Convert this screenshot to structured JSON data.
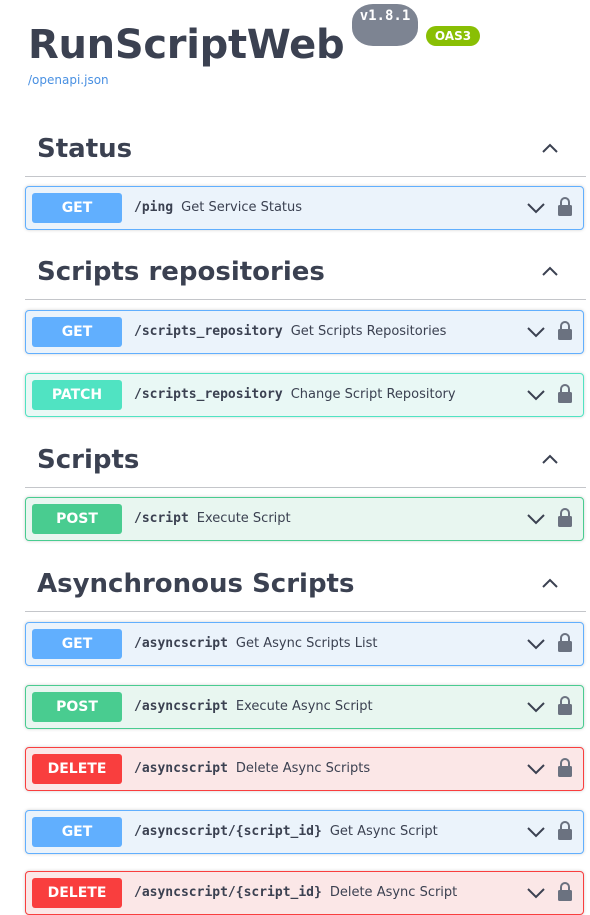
{
  "info": {
    "title": "RunScriptWeb",
    "version": "v1.8.1",
    "oas_badge": "OAS3",
    "spec_link": "/openapi.json"
  },
  "sections": [
    {
      "title": "Status",
      "operations": [
        {
          "method": "GET",
          "path": "/ping",
          "summary": "Get Service Status"
        }
      ]
    },
    {
      "title": "Scripts repositories",
      "operations": [
        {
          "method": "GET",
          "path": "/scripts_repository",
          "summary": "Get Scripts Repositories"
        },
        {
          "method": "PATCH",
          "path": "/scripts_repository",
          "summary": "Change Script Repository"
        }
      ]
    },
    {
      "title": "Scripts",
      "operations": [
        {
          "method": "POST",
          "path": "/script",
          "summary": "Execute Script"
        }
      ]
    },
    {
      "title": "Asynchronous Scripts",
      "operations": [
        {
          "method": "GET",
          "path": "/asyncscript",
          "summary": "Get Async Scripts List"
        },
        {
          "method": "POST",
          "path": "/asyncscript",
          "summary": "Execute Async Script"
        },
        {
          "method": "DELETE",
          "path": "/asyncscript",
          "summary": "Delete Async Scripts"
        },
        {
          "method": "GET",
          "path": "/asyncscript/{script_id}",
          "summary": "Get Async Script"
        },
        {
          "method": "DELETE",
          "path": "/asyncscript/{script_id}",
          "summary": "Delete Async Script"
        }
      ]
    }
  ],
  "colors": {
    "get": "#61affe",
    "patch": "#50e3c2",
    "post": "#49cc90",
    "delete": "#f93e3e",
    "version_badge": "#7d8492",
    "oas_badge": "#89bf04"
  },
  "icons": {
    "section_toggle": "chevron-up-icon",
    "operation_toggle": "chevron-down-icon",
    "auth": "lock-icon"
  }
}
